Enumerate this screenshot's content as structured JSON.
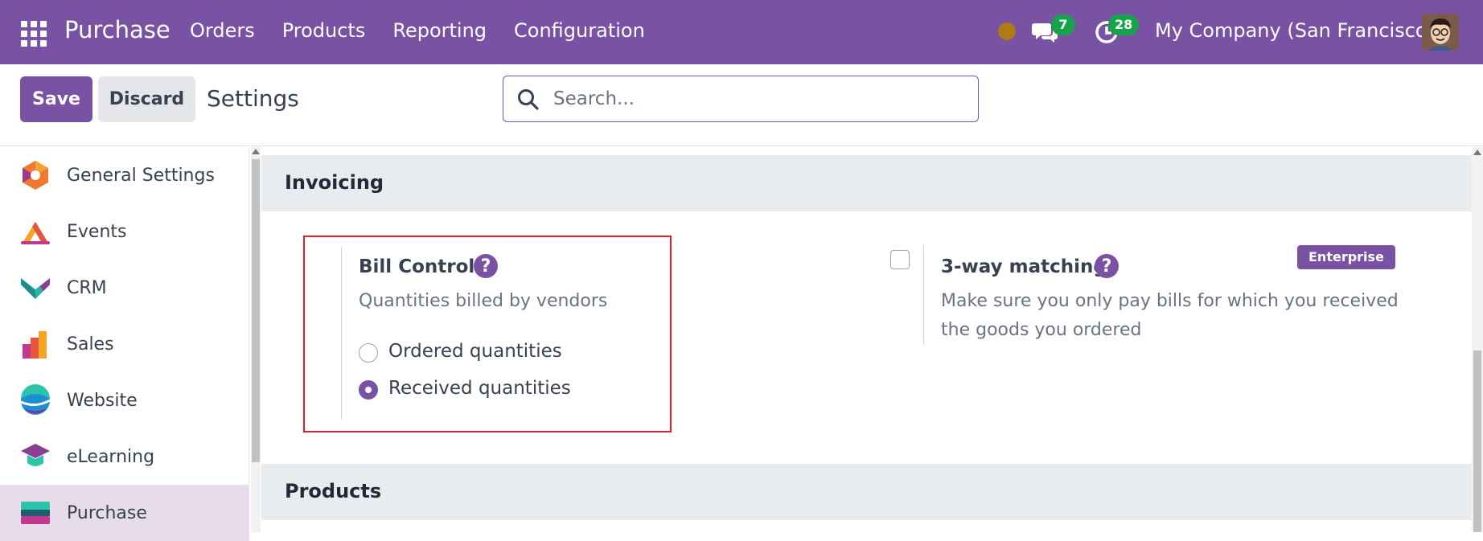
{
  "navbar": {
    "app_name": "Purchase",
    "menu": [
      "Orders",
      "Products",
      "Reporting",
      "Configuration"
    ],
    "messages_count": "7",
    "activities_count": "28",
    "company": "My Company (San Francisco)",
    "color": "#7a52a3"
  },
  "control_panel": {
    "save_label": "Save",
    "discard_label": "Discard",
    "title": "Settings",
    "search_placeholder": "Search..."
  },
  "sidebar": {
    "items": [
      {
        "label": "General Settings",
        "icon": "general-settings-icon"
      },
      {
        "label": "Events",
        "icon": "events-icon"
      },
      {
        "label": "CRM",
        "icon": "crm-icon"
      },
      {
        "label": "Sales",
        "icon": "sales-icon"
      },
      {
        "label": "Website",
        "icon": "website-icon"
      },
      {
        "label": "eLearning",
        "icon": "elearning-icon"
      },
      {
        "label": "Purchase",
        "icon": "purchase-icon",
        "active": true
      }
    ]
  },
  "sections": {
    "invoicing": {
      "title": "Invoicing",
      "bill_control": {
        "title": "Bill Control",
        "description": "Quantities billed by vendors",
        "options": [
          "Ordered quantities",
          "Received quantities"
        ],
        "selected": "Received quantities"
      },
      "three_way": {
        "title": "3-way matching",
        "description": "Make sure you only pay bills for which you received the goods you ordered",
        "badge": "Enterprise",
        "checked": false
      }
    },
    "products": {
      "title": "Products"
    }
  },
  "help_glyph": "?"
}
